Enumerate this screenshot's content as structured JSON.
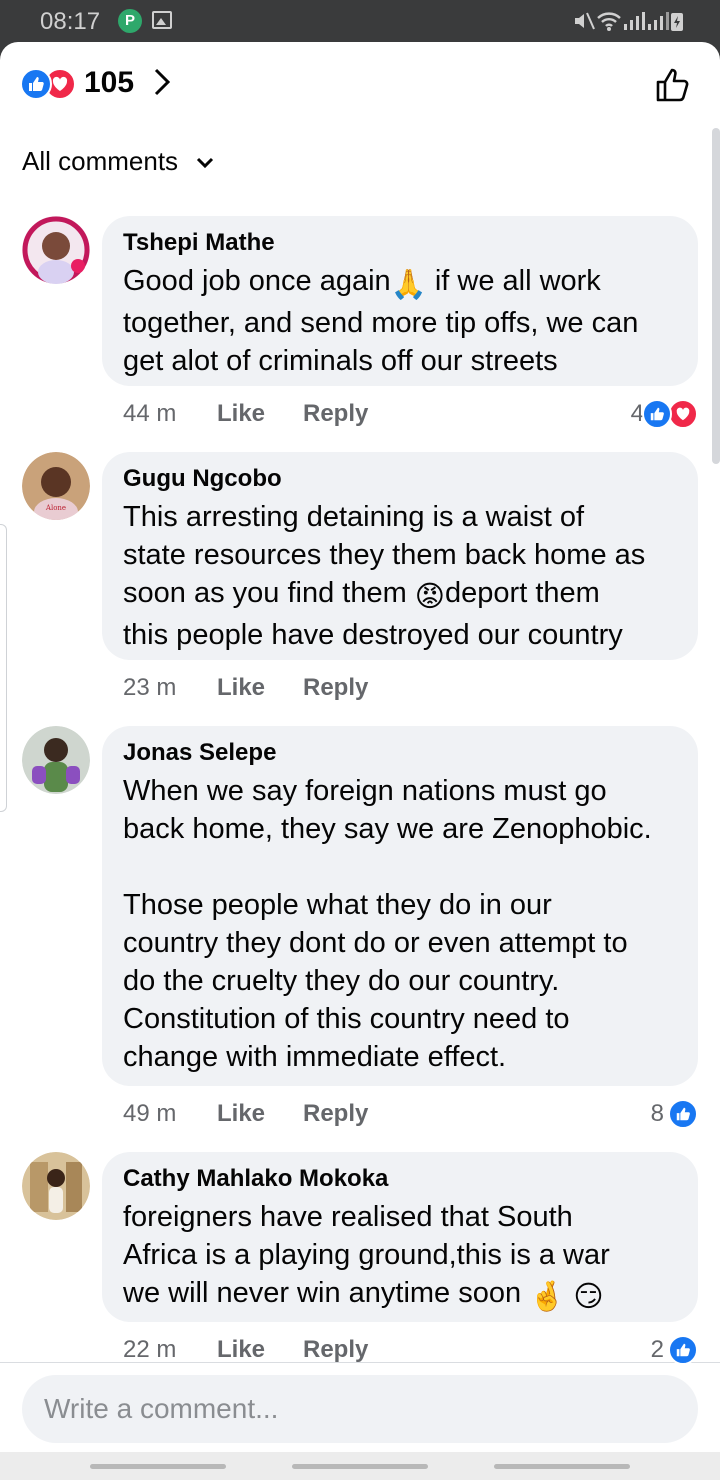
{
  "status_bar": {
    "time": "08:17",
    "icons": [
      "app-p-icon",
      "image-icon",
      "mute-icon",
      "wifi-icon",
      "signal-icon",
      "signal-icon",
      "battery-charging-icon"
    ]
  },
  "reactions": {
    "count": "105",
    "icons": [
      "like-reaction-icon",
      "love-reaction-icon"
    ]
  },
  "sort": {
    "label": "All comments"
  },
  "comments": [
    {
      "author": "Tshepi Mathe",
      "text_a": "Good job once again",
      "emoji_a": "🙏",
      "text_b": " if we all work\ntogether, and send more tip offs, we can\nget alot of criminals off our streets",
      "time": "44 m",
      "like": "Like",
      "reply": "Reply",
      "reaction_count": "4",
      "reaction_icons": [
        "like-reaction-icon",
        "love-reaction-icon"
      ]
    },
    {
      "author": "Gugu Ngcobo",
      "text_a": "This arresting detaining is a waist of\nstate resources they them back home as\nsoon as you find them ",
      "emoji_a": "😡",
      "text_b": "deport them\nthis people have destroyed our country",
      "time": "23 m",
      "like": "Like",
      "reply": "Reply"
    },
    {
      "author": "Jonas Selepe",
      "text": "When we say foreign nations must go\nback home, they say we are Zenophobic.\n\nThose people what they do in our\ncountry they dont do or even attempt to\ndo the cruelty they do our country.\nConstitution of this country need to\nchange with immediate effect.",
      "time": "49 m",
      "like": "Like",
      "reply": "Reply",
      "reaction_count": "8",
      "reaction_icons": [
        "like-reaction-icon"
      ]
    },
    {
      "author": "Cathy Mahlako Mokoka",
      "text": "foreigners have realised that South\nAfrica is a playing ground,this is a war\nwe will never win anytime soon ",
      "emoji_a": "🤞",
      "emoji_b": "😏",
      "time": "22 m",
      "like": "Like",
      "reply": "Reply",
      "reaction_count": "2",
      "reaction_icons": [
        "like-reaction-icon"
      ]
    }
  ],
  "composer": {
    "placeholder": "Write a comment..."
  },
  "colors": {
    "like": "#1877f2",
    "love": "#f02849",
    "bubble": "#f0f2f5",
    "meta": "#65676b"
  }
}
